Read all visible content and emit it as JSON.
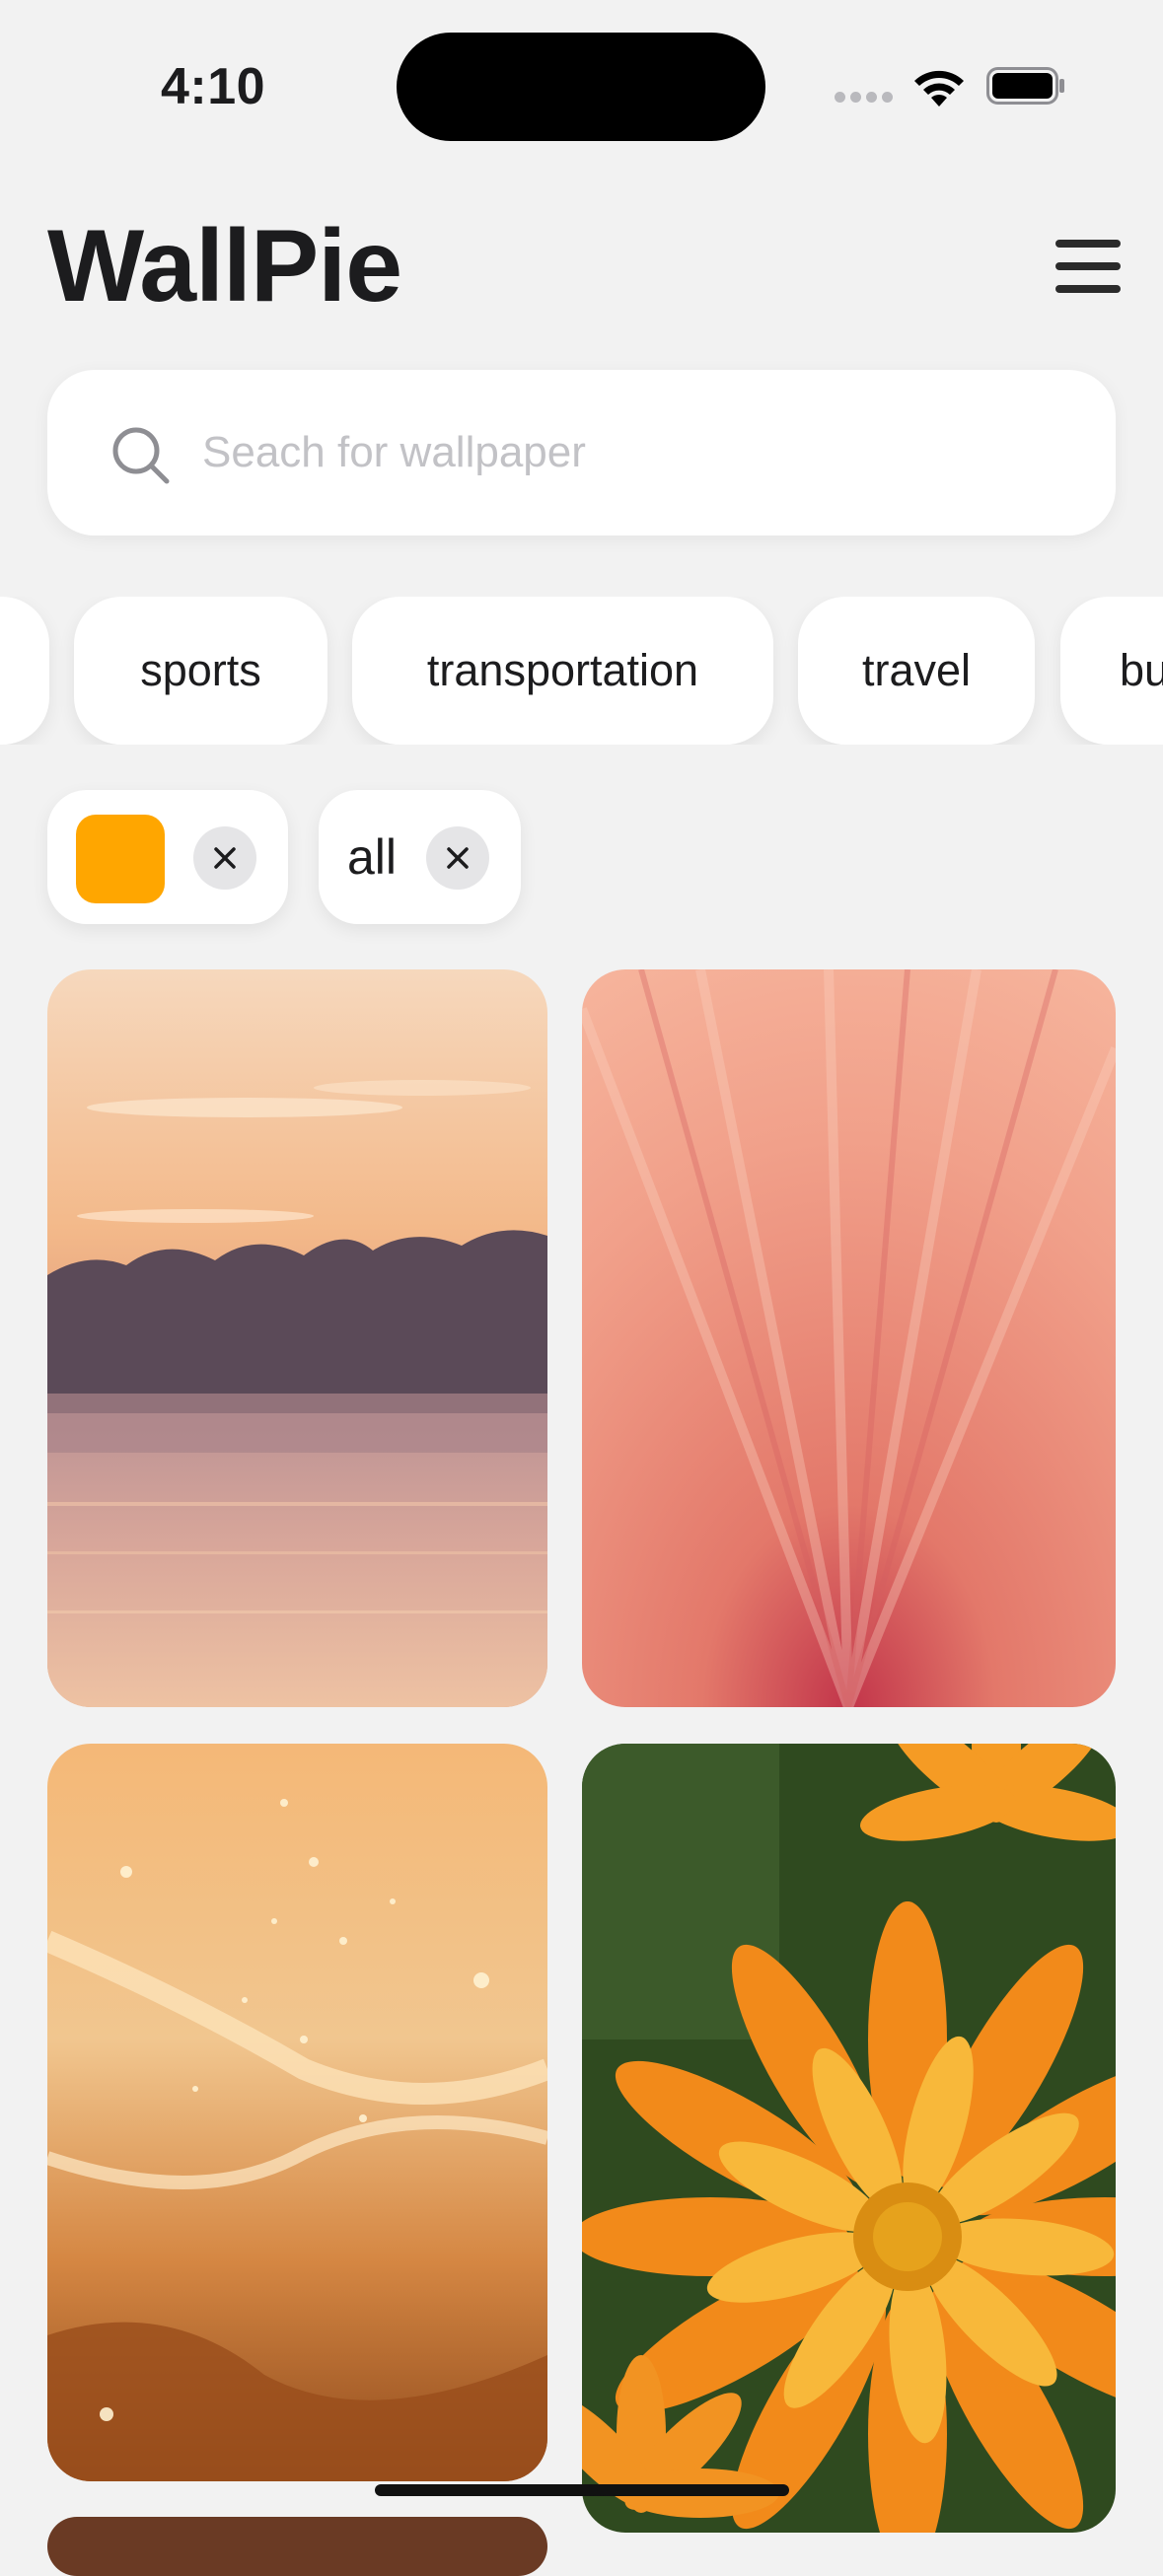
{
  "status_bar": {
    "time": "4:10"
  },
  "header": {
    "title": "WallPie",
    "menu_icon": "hamburger-menu-icon"
  },
  "search": {
    "placeholder": "Seach for wallpaper",
    "value": "",
    "icon": "search-icon"
  },
  "categories": [
    {
      "label": ""
    },
    {
      "label": "sports"
    },
    {
      "label": "transportation"
    },
    {
      "label": "travel"
    },
    {
      "label": "bu"
    }
  ],
  "active_filters": {
    "color": {
      "swatch": "#FFA600",
      "clear_icon": "close-icon"
    },
    "type": {
      "label": "all",
      "clear_icon": "close-icon"
    }
  },
  "wallpapers": [
    {
      "subject": "sunset-lake",
      "palette": [
        "#f4c49a",
        "#c98e7c",
        "#e7b59d"
      ]
    },
    {
      "subject": "peach-rays",
      "palette": [
        "#f19a84",
        "#e77a6a",
        "#c13a48"
      ]
    },
    {
      "subject": "golden-sparkle-waves",
      "palette": [
        "#f7c98c",
        "#d98a3c",
        "#9a4d1c"
      ]
    },
    {
      "subject": "orange-flower",
      "palette": [
        "#f6a623",
        "#e36d12",
        "#2f4a1f"
      ]
    }
  ]
}
